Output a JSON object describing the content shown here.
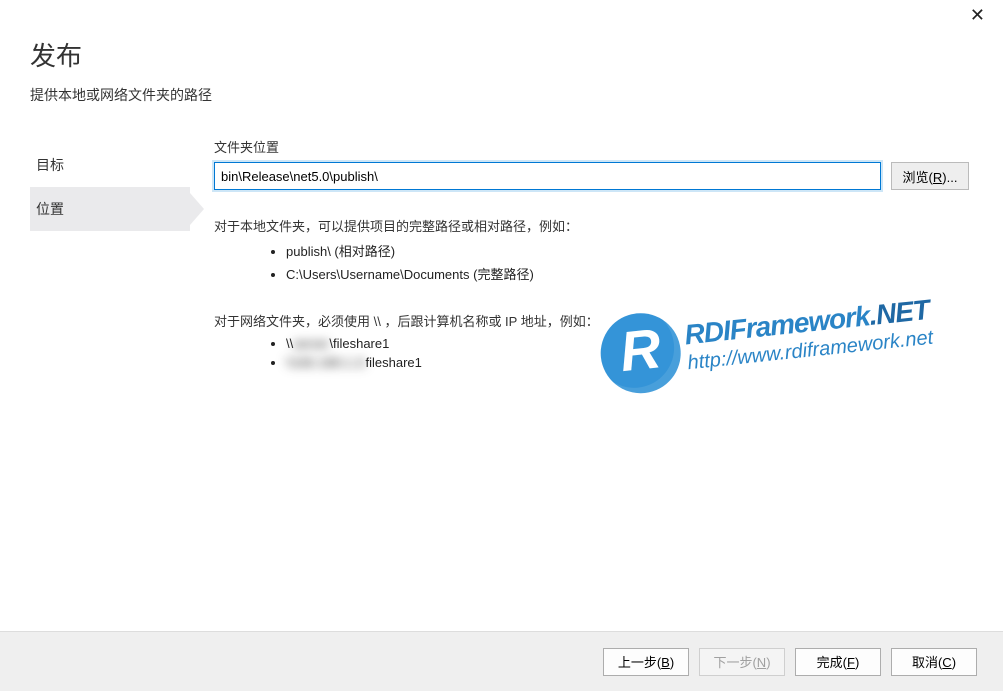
{
  "window": {
    "close_label": "✕"
  },
  "header": {
    "title": "发布",
    "subtitle": "提供本地或网络文件夹的路径"
  },
  "sidebar": {
    "items": [
      {
        "label": "目标"
      },
      {
        "label": "位置"
      }
    ],
    "active_index": 1
  },
  "main": {
    "folder_location_label": "文件夹位置",
    "folder_location_value": "bin\\Release\\net5.0\\publish\\",
    "browse_button": "浏览(R)...",
    "info_local": "对于本地文件夹，可以提供项目的完整路径或相对路径，例如：",
    "examples_local": [
      "publish\\ (相对路径)",
      "C:\\Users\\Username\\Documents (完整路径)"
    ],
    "info_network": "对于网络文件夹，必须使用 \\\\ ，后跟计算机名称或 IP 地址，例如：",
    "examples_network": [
      {
        "pre": "\\\\",
        "blur": "server",
        "post": "\\fileshare1"
      },
      {
        "pre": "",
        "blur": "\\\\192.168.1.1\\",
        "post": "fileshare1"
      }
    ]
  },
  "watermark": {
    "glyph": "R",
    "line1a": "RDIFramework",
    "line1b": ".NET",
    "line2": "http://www.rdiframework.net"
  },
  "footer": {
    "back": "上一步(B)",
    "next": "下一步(N)",
    "finish": "完成(F)",
    "cancel": "取消(C)"
  }
}
